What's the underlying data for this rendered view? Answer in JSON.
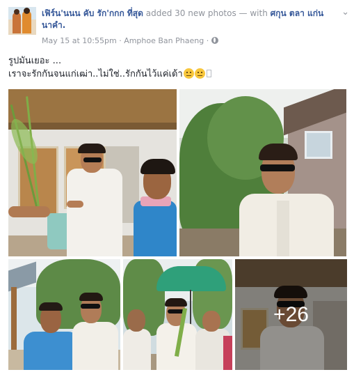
{
  "post": {
    "author_name": "เฟิร์น'นนน คับ รัก'กกก ที่สุด",
    "action_text": "added 30 new photos",
    "with_text": "— with",
    "tagged_names": "ศกุน ตลา แก่นนาคำ.",
    "timestamp": "May 15 at 10:55pm",
    "separator": "·",
    "location": "Amphoe Ban Phaeng",
    "privacy_icon": "globe-icon",
    "menu_icon": "chevron-down-icon",
    "caption_line1": "รูปมันเยอะ ...",
    "caption_line2": "เราจะรักกันจนแก่เฒ่า..ไม่ใช่..รักกันไว้แค่เด้า"
  },
  "photos": {
    "count": 5,
    "more_label": "+26"
  },
  "colors": {
    "link": "#365899",
    "meta": "#90949c",
    "text": "#1d2129",
    "background": "#ffffff"
  }
}
